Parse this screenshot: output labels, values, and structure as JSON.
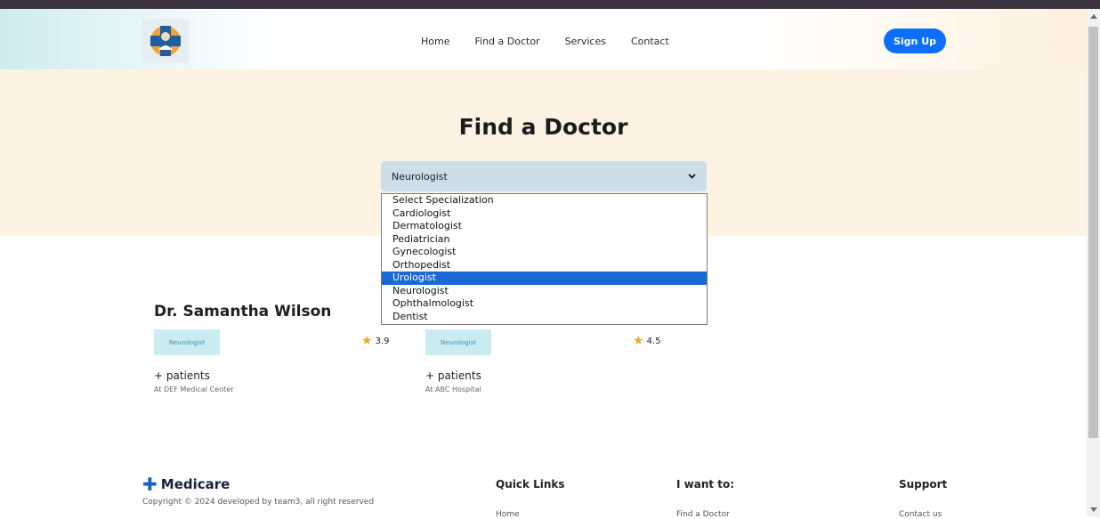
{
  "header": {
    "nav": [
      "Home",
      "Find a Doctor",
      "Services",
      "Contact"
    ],
    "signup_label": "Sign Up"
  },
  "hero": {
    "title": "Find a Doctor",
    "select_value": "Neurologist",
    "options": [
      "Select Specialization",
      "Cardiologist",
      "Dermatologist",
      "Pediatrician",
      "Gynecologist",
      "Orthopedist",
      "Urologist",
      "Neurologist",
      "Ophthalmologist",
      "Dentist"
    ],
    "highlighted_option": "Urologist"
  },
  "doctors": [
    {
      "name": "Dr. Samantha Wilson",
      "specialization": "Neurologist",
      "rating": "3.9",
      "patients": "+ patients",
      "location": "At DEF Medical Center"
    },
    {
      "name": "",
      "specialization": "Neurologist",
      "rating": "4.5",
      "patients": "+ patients",
      "location": "At ABC Hospital"
    }
  ],
  "footer": {
    "brand": "Medicare",
    "copyright": "Copyright © 2024 developed by team3, all right reserved",
    "columns": [
      {
        "heading": "Quick Links",
        "link": "Home"
      },
      {
        "heading": "I want to:",
        "link": "Find a Doctor"
      },
      {
        "heading": "Support",
        "link": "Contact us"
      }
    ]
  },
  "colors": {
    "accent": "#0d6efd",
    "hero_bg": "#fdf3e2",
    "badge_bg": "#c9ecf1",
    "star": "#f5a623",
    "highlight": "#1a69d4"
  }
}
